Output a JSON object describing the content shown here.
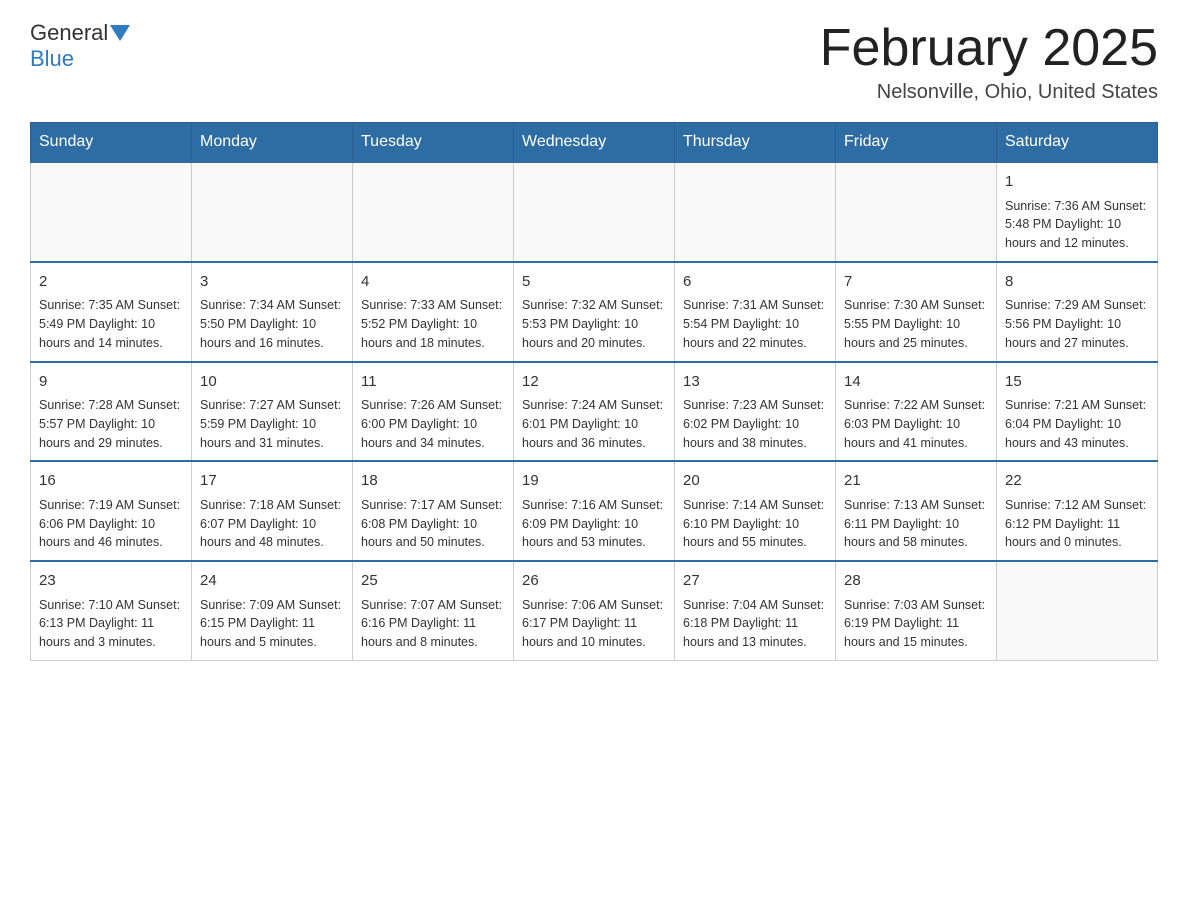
{
  "header": {
    "logo_general": "General",
    "logo_blue": "Blue",
    "title": "February 2025",
    "subtitle": "Nelsonville, Ohio, United States"
  },
  "days_of_week": [
    "Sunday",
    "Monday",
    "Tuesday",
    "Wednesday",
    "Thursday",
    "Friday",
    "Saturday"
  ],
  "weeks": [
    [
      {
        "day": "",
        "info": ""
      },
      {
        "day": "",
        "info": ""
      },
      {
        "day": "",
        "info": ""
      },
      {
        "day": "",
        "info": ""
      },
      {
        "day": "",
        "info": ""
      },
      {
        "day": "",
        "info": ""
      },
      {
        "day": "1",
        "info": "Sunrise: 7:36 AM\nSunset: 5:48 PM\nDaylight: 10 hours and 12 minutes."
      }
    ],
    [
      {
        "day": "2",
        "info": "Sunrise: 7:35 AM\nSunset: 5:49 PM\nDaylight: 10 hours and 14 minutes."
      },
      {
        "day": "3",
        "info": "Sunrise: 7:34 AM\nSunset: 5:50 PM\nDaylight: 10 hours and 16 minutes."
      },
      {
        "day": "4",
        "info": "Sunrise: 7:33 AM\nSunset: 5:52 PM\nDaylight: 10 hours and 18 minutes."
      },
      {
        "day": "5",
        "info": "Sunrise: 7:32 AM\nSunset: 5:53 PM\nDaylight: 10 hours and 20 minutes."
      },
      {
        "day": "6",
        "info": "Sunrise: 7:31 AM\nSunset: 5:54 PM\nDaylight: 10 hours and 22 minutes."
      },
      {
        "day": "7",
        "info": "Sunrise: 7:30 AM\nSunset: 5:55 PM\nDaylight: 10 hours and 25 minutes."
      },
      {
        "day": "8",
        "info": "Sunrise: 7:29 AM\nSunset: 5:56 PM\nDaylight: 10 hours and 27 minutes."
      }
    ],
    [
      {
        "day": "9",
        "info": "Sunrise: 7:28 AM\nSunset: 5:57 PM\nDaylight: 10 hours and 29 minutes."
      },
      {
        "day": "10",
        "info": "Sunrise: 7:27 AM\nSunset: 5:59 PM\nDaylight: 10 hours and 31 minutes."
      },
      {
        "day": "11",
        "info": "Sunrise: 7:26 AM\nSunset: 6:00 PM\nDaylight: 10 hours and 34 minutes."
      },
      {
        "day": "12",
        "info": "Sunrise: 7:24 AM\nSunset: 6:01 PM\nDaylight: 10 hours and 36 minutes."
      },
      {
        "day": "13",
        "info": "Sunrise: 7:23 AM\nSunset: 6:02 PM\nDaylight: 10 hours and 38 minutes."
      },
      {
        "day": "14",
        "info": "Sunrise: 7:22 AM\nSunset: 6:03 PM\nDaylight: 10 hours and 41 minutes."
      },
      {
        "day": "15",
        "info": "Sunrise: 7:21 AM\nSunset: 6:04 PM\nDaylight: 10 hours and 43 minutes."
      }
    ],
    [
      {
        "day": "16",
        "info": "Sunrise: 7:19 AM\nSunset: 6:06 PM\nDaylight: 10 hours and 46 minutes."
      },
      {
        "day": "17",
        "info": "Sunrise: 7:18 AM\nSunset: 6:07 PM\nDaylight: 10 hours and 48 minutes."
      },
      {
        "day": "18",
        "info": "Sunrise: 7:17 AM\nSunset: 6:08 PM\nDaylight: 10 hours and 50 minutes."
      },
      {
        "day": "19",
        "info": "Sunrise: 7:16 AM\nSunset: 6:09 PM\nDaylight: 10 hours and 53 minutes."
      },
      {
        "day": "20",
        "info": "Sunrise: 7:14 AM\nSunset: 6:10 PM\nDaylight: 10 hours and 55 minutes."
      },
      {
        "day": "21",
        "info": "Sunrise: 7:13 AM\nSunset: 6:11 PM\nDaylight: 10 hours and 58 minutes."
      },
      {
        "day": "22",
        "info": "Sunrise: 7:12 AM\nSunset: 6:12 PM\nDaylight: 11 hours and 0 minutes."
      }
    ],
    [
      {
        "day": "23",
        "info": "Sunrise: 7:10 AM\nSunset: 6:13 PM\nDaylight: 11 hours and 3 minutes."
      },
      {
        "day": "24",
        "info": "Sunrise: 7:09 AM\nSunset: 6:15 PM\nDaylight: 11 hours and 5 minutes."
      },
      {
        "day": "25",
        "info": "Sunrise: 7:07 AM\nSunset: 6:16 PM\nDaylight: 11 hours and 8 minutes."
      },
      {
        "day": "26",
        "info": "Sunrise: 7:06 AM\nSunset: 6:17 PM\nDaylight: 11 hours and 10 minutes."
      },
      {
        "day": "27",
        "info": "Sunrise: 7:04 AM\nSunset: 6:18 PM\nDaylight: 11 hours and 13 minutes."
      },
      {
        "day": "28",
        "info": "Sunrise: 7:03 AM\nSunset: 6:19 PM\nDaylight: 11 hours and 15 minutes."
      },
      {
        "day": "",
        "info": ""
      }
    ]
  ]
}
